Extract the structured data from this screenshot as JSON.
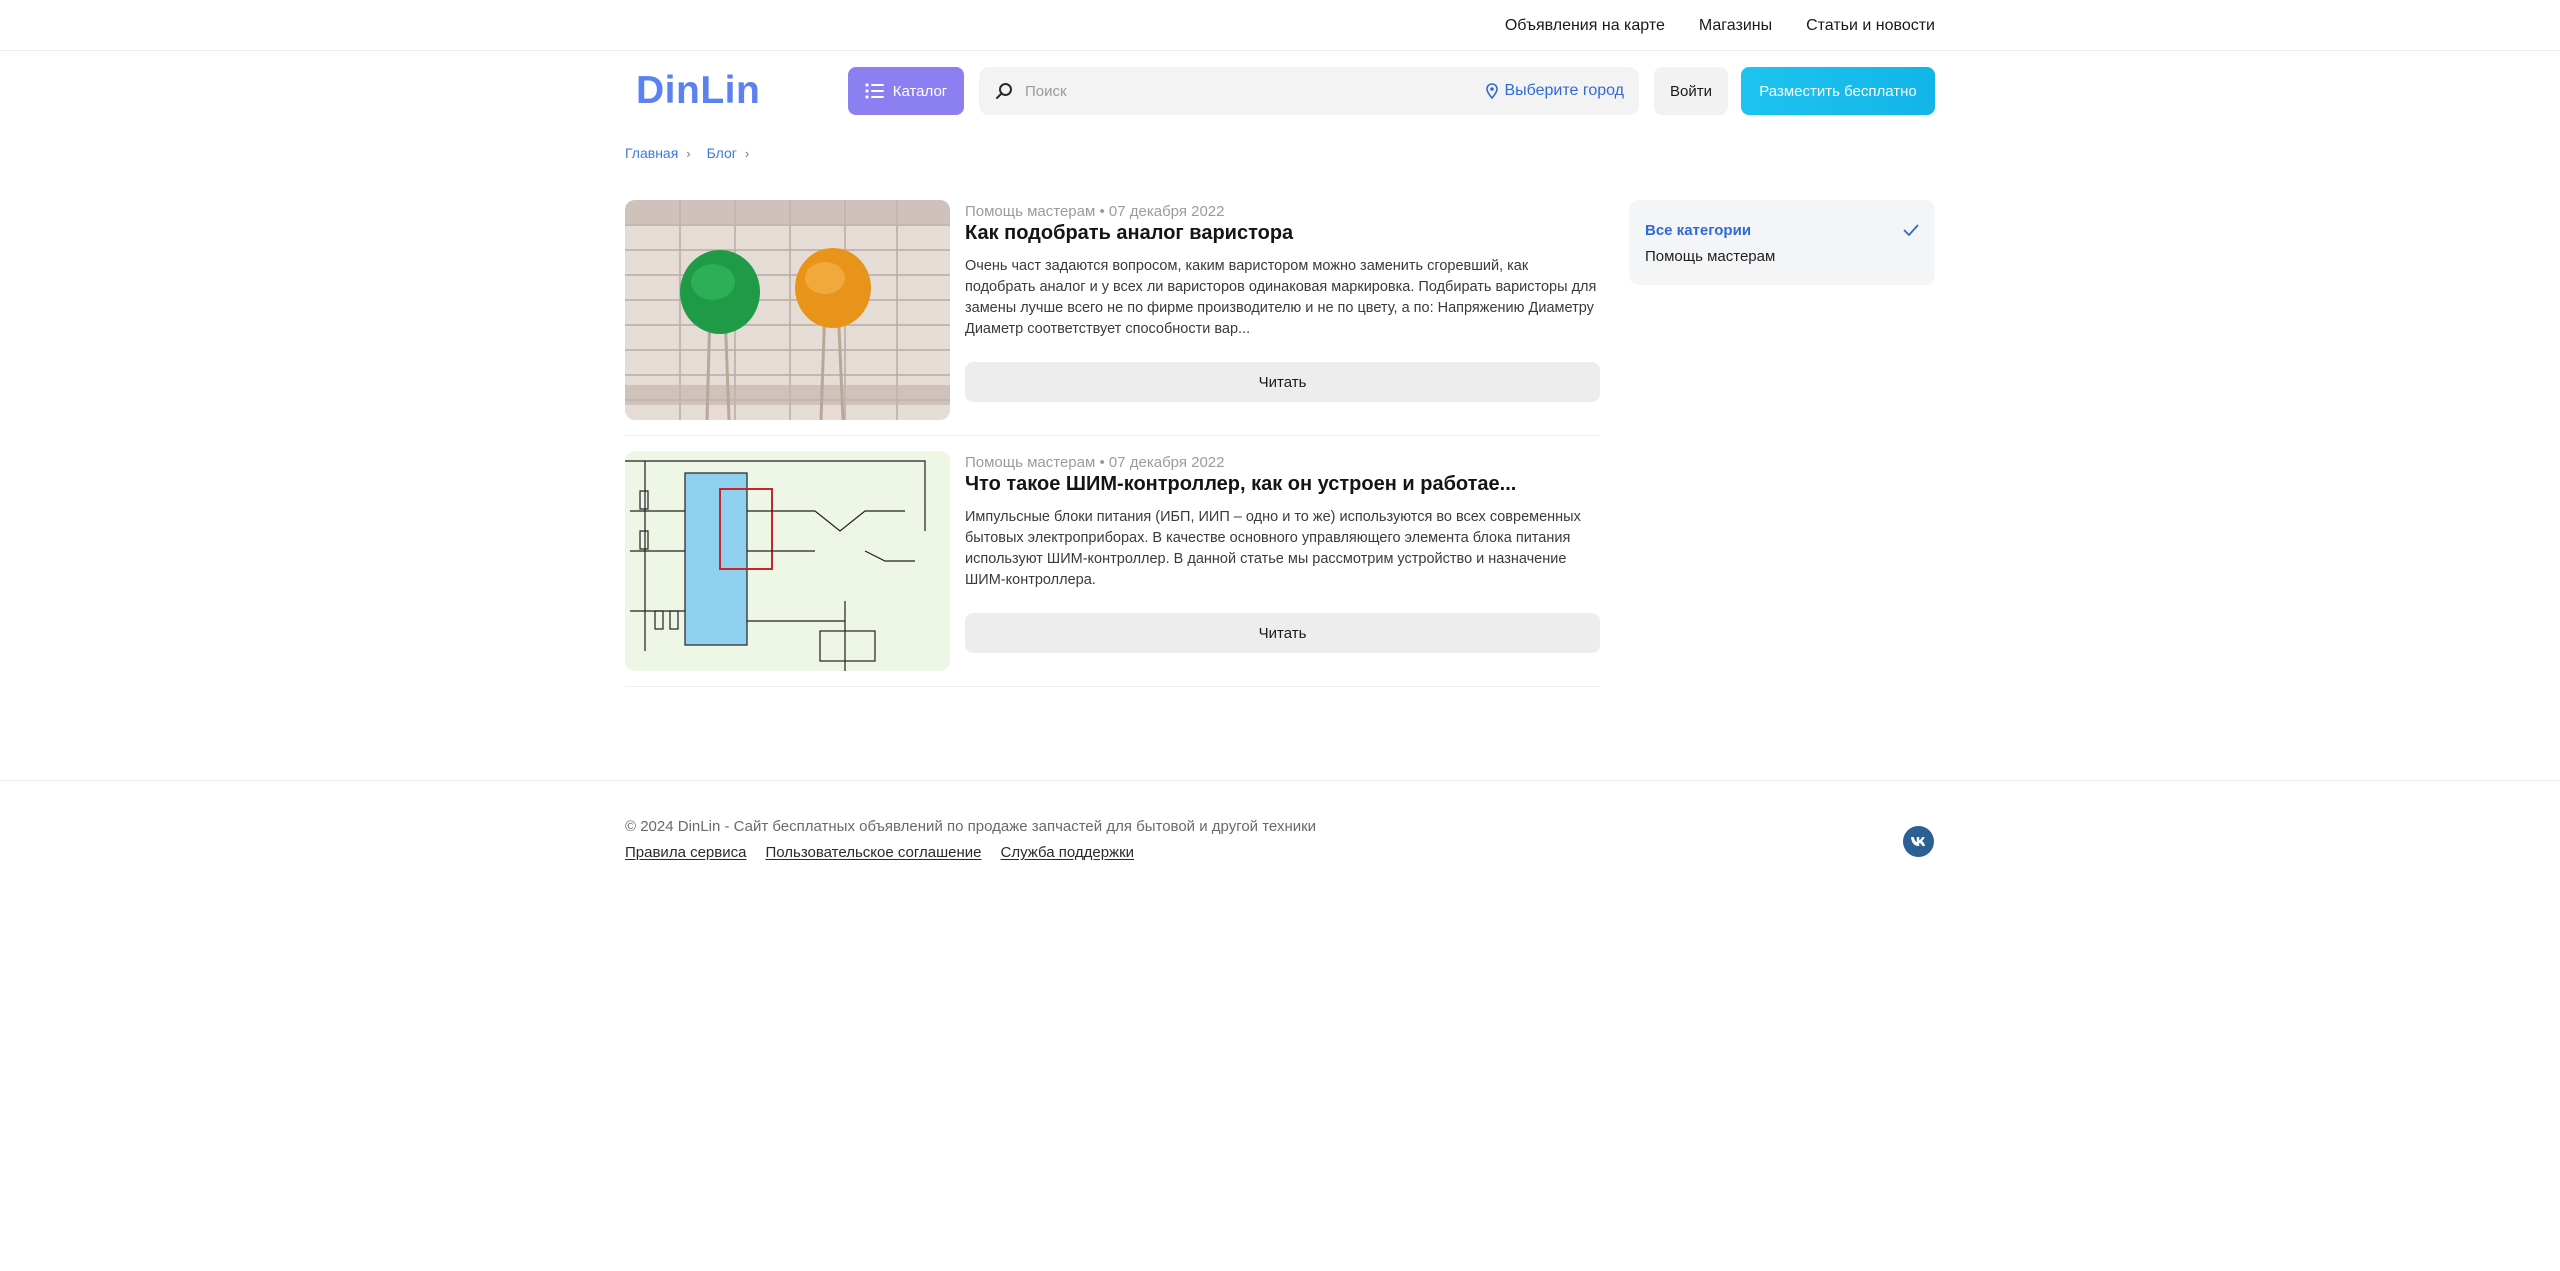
{
  "topbar": {
    "links": [
      "Объявления на карте",
      "Магазины",
      "Статьи и новости"
    ]
  },
  "header": {
    "logo": "DinLin",
    "catalog_label": "Каталог",
    "search_placeholder": "Поиск",
    "city_label": "Выберите город",
    "login_label": "Войти",
    "post_label": "Разместить бесплатно",
    "colors": {
      "logo": "#5b82f0",
      "catalog": "#8c7ff2",
      "post": "#12b5e8",
      "city": "#2f6ad4"
    }
  },
  "breadcrumb": {
    "items": [
      "Главная",
      "Блог"
    ]
  },
  "articles": [
    {
      "thumb_icon": "varistor-photo",
      "meta": "Помощь мастерам • 07 декабря 2022",
      "title": "Как подобрать аналог варистора",
      "excerpt": "Очень част задаются вопросом, каким варистором можно заменить сгоревший, как подобрать аналог и у всех ли варисторов одинаковая маркировка.   Подбирать варисторы для замены лучше всего не по фирме производителю и не по цвету, а по: Напряжению  Диаметру   Диаметр соответствует способности вар...",
      "read_label": "Читать"
    },
    {
      "thumb_icon": "pwm-circuit-schematic",
      "meta": "Помощь мастерам • 07 декабря 2022",
      "title": "Что такое ШИМ-контроллер, как он устроен и работае...",
      "excerpt": "Импульсные блоки питания (ИБП, ИИП – одно и то же) используются во всех современных бытовых электроприборах. В качестве основного управляющего элемента блока питания используют ШИМ-контроллер. В данной статье мы рассмотрим устройство и назначение ШИМ-контроллера.",
      "read_label": "Читать"
    }
  ],
  "categories": {
    "items": [
      {
        "label": "Все категории",
        "active": true
      },
      {
        "label": "Помощь мастерам",
        "active": false
      }
    ]
  },
  "footer": {
    "copyright": "© 2024 DinLin - Сайт бесплатных объявлений по продаже запчастей для бытовой и другой техники",
    "links": [
      "Правила сервиса",
      "Пользовательское соглашение",
      "Служба поддержки"
    ],
    "social_icon": "vk-icon"
  }
}
